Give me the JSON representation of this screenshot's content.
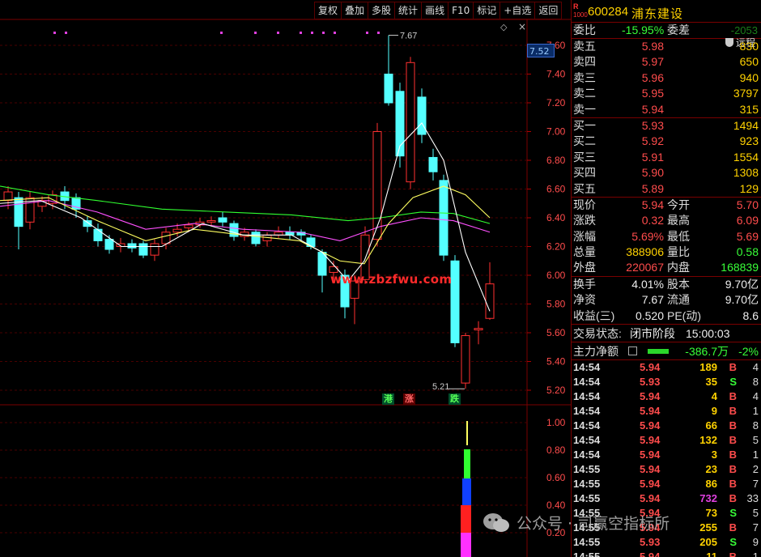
{
  "toolbar": {
    "items": [
      "复权",
      "叠加",
      "多股",
      "统计",
      "画线",
      "F10",
      "标记",
      "+自选",
      "返回"
    ]
  },
  "chart": {
    "price_tag": "7.52",
    "y_axis_main": [
      "7.60",
      "7.40",
      "7.20",
      "7.00",
      "6.80",
      "6.60",
      "6.40",
      "6.20",
      "6.00",
      "5.80",
      "5.60",
      "5.40",
      "5.20"
    ],
    "y_axis_sub": [
      "1.00",
      "0.80",
      "0.60",
      "0.40",
      "0.20"
    ],
    "high_label": "7.67",
    "low_label": "5.21",
    "watermark": "www.zbzfwu.com",
    "tags": {
      "gang": "港",
      "zhang": "涨",
      "die": "跌"
    },
    "colors": {
      "up": "#ff3030",
      "down": "#54ffff",
      "ma1": "#ffffff",
      "ma2": "#ffff60",
      "ma3": "#ff50ff",
      "ma4": "#30ff30"
    }
  },
  "header": {
    "badge_r": "R",
    "badge_sub": "1000",
    "code": "600284",
    "name": "浦东建设",
    "remote": "远程"
  },
  "weibi": {
    "label": "委比",
    "value": "-15.95%",
    "label2": "委差",
    "value2": "-2053"
  },
  "asks": [
    {
      "label": "卖五",
      "price": "5.98",
      "vol": "830"
    },
    {
      "label": "卖四",
      "price": "5.97",
      "vol": "650"
    },
    {
      "label": "卖三",
      "price": "5.96",
      "vol": "940"
    },
    {
      "label": "卖二",
      "price": "5.95",
      "vol": "3797"
    },
    {
      "label": "卖一",
      "price": "5.94",
      "vol": "315"
    }
  ],
  "bids": [
    {
      "label": "买一",
      "price": "5.93",
      "vol": "1494"
    },
    {
      "label": "买二",
      "price": "5.92",
      "vol": "923"
    },
    {
      "label": "买三",
      "price": "5.91",
      "vol": "1554"
    },
    {
      "label": "买四",
      "price": "5.90",
      "vol": "1308"
    },
    {
      "label": "买五",
      "price": "5.89",
      "vol": "129"
    }
  ],
  "stats": [
    {
      "l1": "现价",
      "v1": "5.94",
      "c1": "red",
      "l2": "今开",
      "v2": "5.70",
      "c2": "red"
    },
    {
      "l1": "涨跌",
      "v1": "0.32",
      "c1": "red",
      "l2": "最高",
      "v2": "6.09",
      "c2": "red"
    },
    {
      "l1": "涨幅",
      "v1": "5.69%",
      "c1": "red",
      "l2": "最低",
      "v2": "5.69",
      "c2": "red"
    },
    {
      "l1": "总量",
      "v1": "388906",
      "c1": "yellow",
      "l2": "量比",
      "v2": "0.58",
      "c2": "green"
    },
    {
      "l1": "外盘",
      "v1": "220067",
      "c1": "red",
      "l2": "内盘",
      "v2": "168839",
      "c2": "green"
    }
  ],
  "stats2": [
    {
      "l1": "换手",
      "v1": "4.01%",
      "l2": "股本",
      "v2": "9.70亿"
    },
    {
      "l1": "净资",
      "v1": "7.67",
      "l2": "流通",
      "v2": "9.70亿"
    },
    {
      "l1": "收益(三)",
      "v1": "0.520",
      "l2": "PE(动)",
      "v2": "8.6"
    }
  ],
  "trade_status": {
    "label": "交易状态:",
    "value": "闭市阶段",
    "time": "15:00:03"
  },
  "zhuli": {
    "label": "主力净额",
    "value": "-386.7万",
    "pct": "-2%"
  },
  "ticks": [
    {
      "t": "14:54",
      "p": "5.94",
      "q": "189",
      "qc": "yellow",
      "d": "B",
      "n": "4"
    },
    {
      "t": "14:54",
      "p": "5.93",
      "q": "35",
      "qc": "yellow",
      "d": "S",
      "n": "8"
    },
    {
      "t": "14:54",
      "p": "5.94",
      "q": "4",
      "qc": "yellow",
      "d": "B",
      "n": "4"
    },
    {
      "t": "14:54",
      "p": "5.94",
      "q": "9",
      "qc": "yellow",
      "d": "B",
      "n": "1"
    },
    {
      "t": "14:54",
      "p": "5.94",
      "q": "66",
      "qc": "yellow",
      "d": "B",
      "n": "8"
    },
    {
      "t": "14:54",
      "p": "5.94",
      "q": "132",
      "qc": "yellow",
      "d": "B",
      "n": "5"
    },
    {
      "t": "14:54",
      "p": "5.94",
      "q": "3",
      "qc": "yellow",
      "d": "B",
      "n": "1"
    },
    {
      "t": "14:55",
      "p": "5.94",
      "q": "23",
      "qc": "yellow",
      "d": "B",
      "n": "2"
    },
    {
      "t": "14:55",
      "p": "5.94",
      "q": "86",
      "qc": "yellow",
      "d": "B",
      "n": "7"
    },
    {
      "t": "14:55",
      "p": "5.94",
      "q": "732",
      "qc": "magenta",
      "d": "B",
      "n": "33"
    },
    {
      "t": "14:55",
      "p": "5.94",
      "q": "73",
      "qc": "yellow",
      "d": "S",
      "n": "5"
    },
    {
      "t": "14:55",
      "p": "5.94",
      "q": "255",
      "qc": "yellow",
      "d": "B",
      "n": "7"
    },
    {
      "t": "14:55",
      "p": "5.93",
      "q": "205",
      "qc": "yellow",
      "d": "S",
      "n": "9"
    },
    {
      "t": "14:55",
      "p": "5.94",
      "q": "11",
      "qc": "yellow",
      "d": "B",
      "n": "1"
    }
  ],
  "footer_watermark": "公众号 · 司赢空指标所"
}
